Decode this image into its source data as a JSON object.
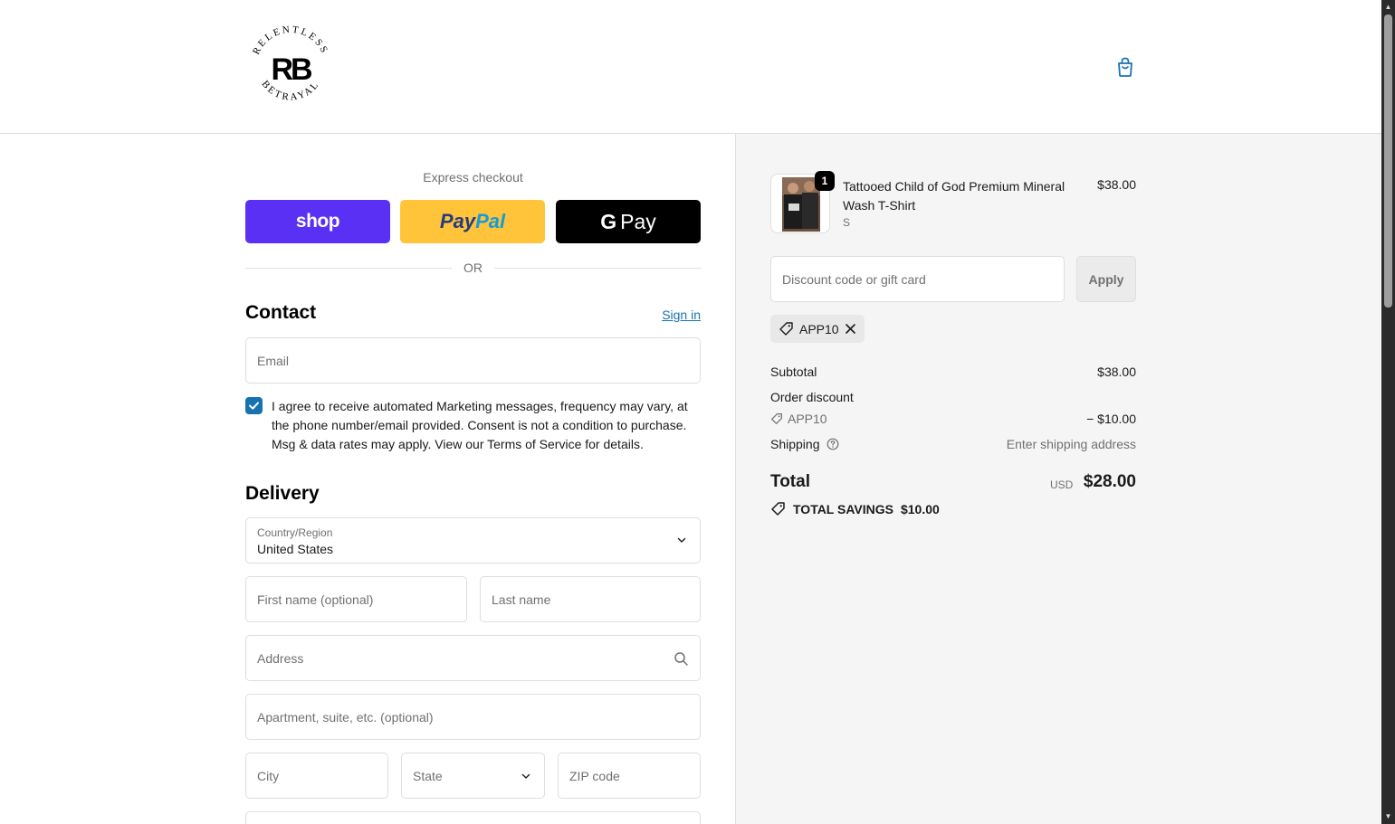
{
  "brand": {
    "logo_top": "RELENTLESS",
    "logo_mark": "RB",
    "logo_bottom": "BETRAYAL"
  },
  "header": {
    "cart_icon": "shopping-bag-icon"
  },
  "express": {
    "title": "Express checkout",
    "shop_label": "shop",
    "paypal_part1": "Pay",
    "paypal_part2": "Pal",
    "gpay_g": "G",
    "gpay_label": "Pay",
    "or_label": "OR"
  },
  "contact": {
    "title": "Contact",
    "signin_label": "Sign in",
    "email_placeholder": "Email",
    "marketing_checked": true,
    "consent_text": "I agree to receive automated Marketing messages, frequency may vary, at the phone number/email provided. Consent is not a condition to purchase. Msg & data rates may apply. View our Terms of Service for details."
  },
  "delivery": {
    "title": "Delivery",
    "country_label": "Country/Region",
    "country_value": "United States",
    "first_name_placeholder": "First name (optional)",
    "last_name_placeholder": "Last name",
    "address_placeholder": "Address",
    "apartment_placeholder": "Apartment, suite, etc. (optional)",
    "city_placeholder": "City",
    "state_placeholder": "State",
    "zip_placeholder": "ZIP code"
  },
  "order": {
    "item": {
      "quantity": "1",
      "name": "Tattooed Child of God Premium Mineral Wash T-Shirt",
      "variant": "S",
      "price": "$38.00"
    },
    "discount_placeholder": "Discount code or gift card",
    "apply_label": "Apply",
    "applied_code": "APP10",
    "subtotal_label": "Subtotal",
    "subtotal_value": "$38.00",
    "order_discount_label": "Order discount",
    "discount_code": "APP10",
    "discount_value": "− $10.00",
    "shipping_label": "Shipping",
    "shipping_value": "Enter shipping address",
    "total_label": "Total",
    "currency": "USD",
    "total_value": "$28.00",
    "savings_label": "TOTAL SAVINGS",
    "savings_value": "$10.00"
  },
  "colors": {
    "accent": "#1773b0",
    "shop_purple": "#5a31f4",
    "paypal_yellow": "#ffc439"
  }
}
